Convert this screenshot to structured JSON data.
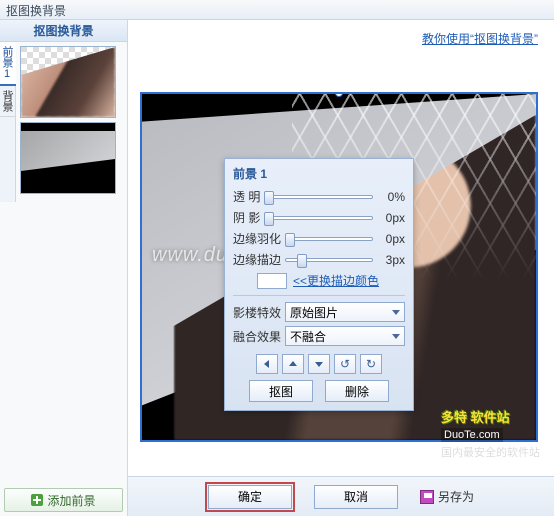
{
  "title_bar": "抠图换背景",
  "sidebar": {
    "tab_label": "抠图换背景",
    "vtabs": [
      "前景1",
      "背景"
    ],
    "add_fg": "添加前景"
  },
  "help_link": "教你使用“抠图换背景”",
  "watermark": "www.duote.com",
  "panel": {
    "title": "前景 1",
    "opacity": {
      "label": "透    明",
      "value": "0%"
    },
    "shadow": {
      "label": "阴    影",
      "value": "0px"
    },
    "feather": {
      "label": "边缘羽化",
      "value": "0px"
    },
    "stroke": {
      "label": "边缘描边",
      "value": "3px"
    },
    "stroke_color_link": "<<更换描边颜色",
    "studio": {
      "label": "影楼特效",
      "value": "原始图片"
    },
    "blend": {
      "label": "融合效果",
      "value": "不融合"
    },
    "nav_icons": [
      "arrow-left",
      "arrow-up",
      "arrow-down",
      "rotate-ccw",
      "rotate-cw"
    ],
    "cutout_btn": "抠图",
    "delete_btn": "删除"
  },
  "logo": {
    "line1": "多特 软件站",
    "line2": "DuoTe.com",
    "line3": "国内最安全的软件站"
  },
  "footer": {
    "ok": "确定",
    "cancel": "取消",
    "save_as": "另存为"
  }
}
